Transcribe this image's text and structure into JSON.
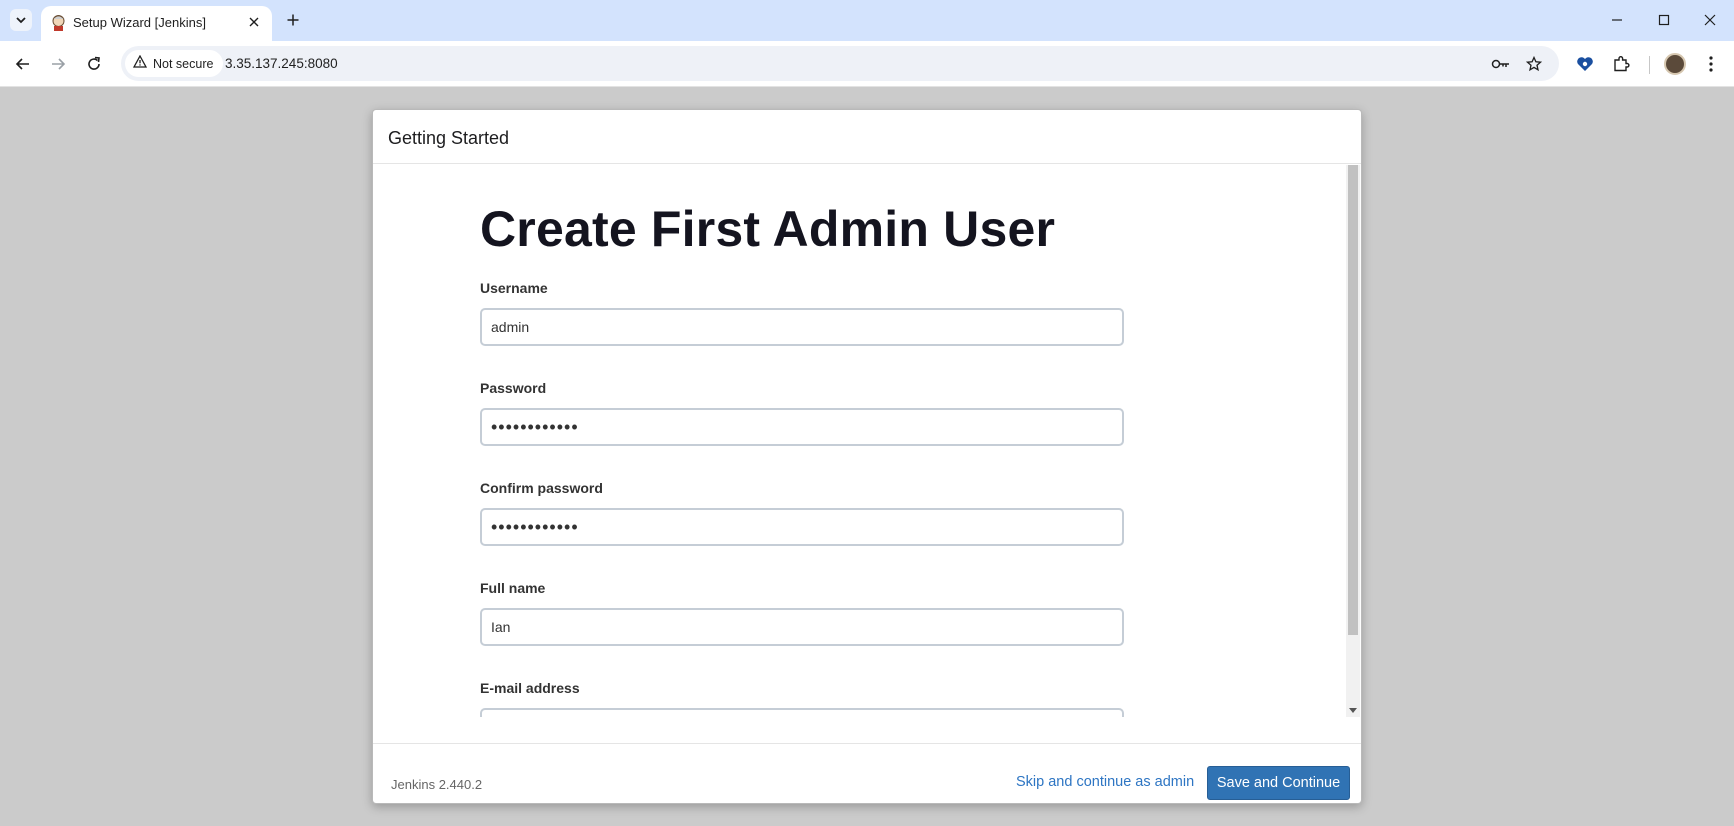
{
  "browser": {
    "tab_title": "Setup Wizard [Jenkins]",
    "security_label": "Not secure",
    "url": "3.35.137.245:8080",
    "icons": [
      "tab-search-icon",
      "jenkins-favicon",
      "close-icon",
      "plus-icon",
      "minimize-icon",
      "maximize-icon",
      "close-window-icon",
      "back-icon",
      "forward-icon",
      "reload-icon",
      "warning-icon",
      "key-icon",
      "star-icon",
      "heart-extension-icon",
      "puzzle-icon",
      "avatar",
      "kebab-menu-icon"
    ]
  },
  "dialog": {
    "header_title": "Getting Started",
    "heading": "Create First Admin User",
    "fields": [
      {
        "label": "Username",
        "value": "admin"
      },
      {
        "label": "Password",
        "value": "••••••••••••"
      },
      {
        "label": "Confirm password",
        "value": "••••••••••••"
      },
      {
        "label": "Full name",
        "value": "Ian"
      },
      {
        "label": "E-mail address",
        "value": ""
      }
    ],
    "version": "Jenkins 2.440.2",
    "skip_label": "Skip and continue as admin",
    "save_label": "Save and Continue"
  },
  "colors": {
    "primary_button": "#3073b4",
    "link": "#2d75c3",
    "tabstrip": "#d3e3fd",
    "backdrop": "#cbcbcb"
  }
}
